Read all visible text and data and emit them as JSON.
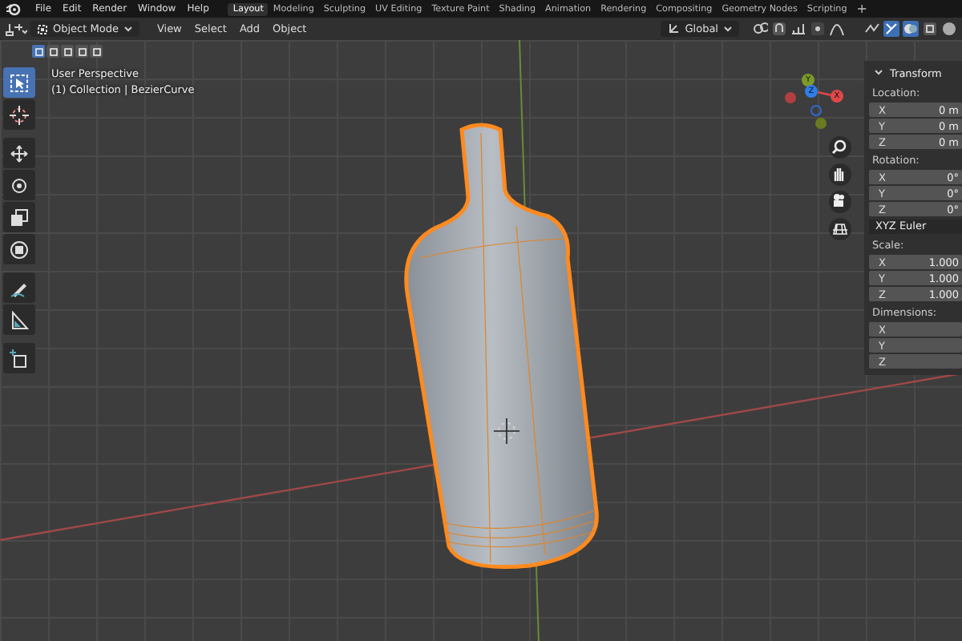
{
  "menu": [
    "File",
    "Edit",
    "Render",
    "Window",
    "Help"
  ],
  "workspaces": [
    {
      "label": "Layout",
      "selected": true
    },
    {
      "label": "Modeling",
      "selected": false
    },
    {
      "label": "Sculpting",
      "selected": false
    },
    {
      "label": "UV Editing",
      "selected": false
    },
    {
      "label": "Texture Paint",
      "selected": false
    },
    {
      "label": "Shading",
      "selected": false
    },
    {
      "label": "Animation",
      "selected": false
    },
    {
      "label": "Rendering",
      "selected": false
    },
    {
      "label": "Compositing",
      "selected": false
    },
    {
      "label": "Geometry Nodes",
      "selected": false
    },
    {
      "label": "Scripting",
      "selected": false
    }
  ],
  "add_workspace": "+",
  "header": {
    "mode": "Object Mode",
    "menus": [
      "View",
      "Select",
      "Add",
      "Object"
    ],
    "orientation": "Global"
  },
  "select_modes": [
    {
      "selected": true
    },
    {
      "selected": false
    },
    {
      "selected": false
    },
    {
      "selected": false
    },
    {
      "selected": false
    }
  ],
  "tools": [
    {
      "kind": "select",
      "selected": true
    },
    {
      "kind": "cursor",
      "selected": false
    },
    {
      "kind": "move",
      "selected": false
    },
    {
      "kind": "rotate",
      "selected": false
    },
    {
      "kind": "scale",
      "selected": false
    },
    {
      "kind": "transform",
      "selected": false
    },
    {
      "kind": "annotate",
      "selected": false
    },
    {
      "kind": "measure",
      "selected": false
    },
    {
      "kind": "add",
      "selected": false
    }
  ],
  "overlay": {
    "view": "User Perspective",
    "object": "(1) Collection | BezierCurve"
  },
  "gizmo": {
    "axes": [
      {
        "label": "Y"
      },
      {
        "label": "Z"
      },
      {
        "label": "X"
      }
    ]
  },
  "panel": {
    "title": "Transform",
    "expanded": true,
    "sections": [
      {
        "label": "Location:",
        "fields": [
          {
            "axis": "X",
            "value": "0 m"
          },
          {
            "axis": "Y",
            "value": "0 m"
          },
          {
            "axis": "Z",
            "value": "0 m"
          }
        ]
      },
      {
        "label": "Rotation:",
        "fields": [
          {
            "axis": "X",
            "value": "0°"
          },
          {
            "axis": "Y",
            "value": "0°"
          },
          {
            "axis": "Z",
            "value": "0°"
          }
        ],
        "mode": "XYZ Euler"
      },
      {
        "label": "Scale:",
        "fields": [
          {
            "axis": "X",
            "value": "1.000"
          },
          {
            "axis": "Y",
            "value": "1.000"
          },
          {
            "axis": "Z",
            "value": "1.000"
          }
        ]
      },
      {
        "label": "Dimensions:",
        "fields": [
          {
            "axis": "X"
          },
          {
            "axis": "Y"
          },
          {
            "axis": "Z"
          }
        ]
      }
    ]
  }
}
